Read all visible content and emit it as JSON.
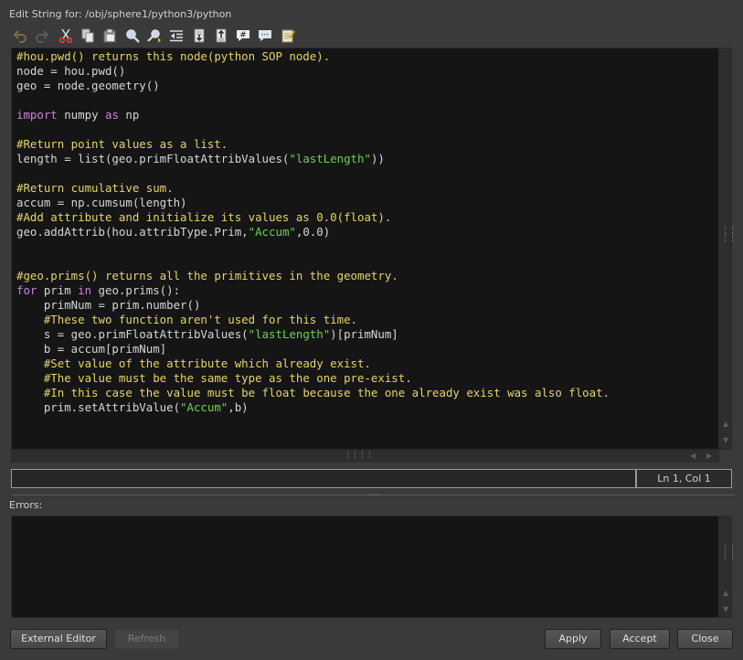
{
  "window": {
    "title": "Edit String for: /obj/sphere1/python3/python"
  },
  "toolbar": {
    "buttons": [
      {
        "name": "undo-icon"
      },
      {
        "name": "redo-icon"
      },
      {
        "name": "cut-icon"
      },
      {
        "name": "copy-icon"
      },
      {
        "name": "paste-icon"
      },
      {
        "name": "find-icon"
      },
      {
        "name": "replace-icon"
      },
      {
        "name": "outdent-icon"
      },
      {
        "name": "indent-icon"
      },
      {
        "name": "unindent-icon"
      },
      {
        "name": "comment-icon"
      },
      {
        "name": "uncomment-icon"
      },
      {
        "name": "notepad-icon"
      }
    ]
  },
  "editor": {
    "lines": [
      [
        {
          "t": "#hou.pwd() returns this node(python SOP node).",
          "c": "c"
        }
      ],
      [
        {
          "t": "node = hou.pwd()"
        }
      ],
      [
        {
          "t": "geo = node.geometry()"
        }
      ],
      [],
      [
        {
          "t": "import",
          "c": "k"
        },
        {
          "t": " numpy "
        },
        {
          "t": "as",
          "c": "k"
        },
        {
          "t": " np"
        }
      ],
      [],
      [
        {
          "t": "#Return point values as a list.",
          "c": "c"
        }
      ],
      [
        {
          "t": "length = list(geo.primFloatAttribValues("
        },
        {
          "t": "\"lastLength\"",
          "c": "s"
        },
        {
          "t": "))"
        }
      ],
      [],
      [
        {
          "t": "#Return cumulative sum.",
          "c": "c"
        }
      ],
      [
        {
          "t": "accum = np.cumsum(length)"
        }
      ],
      [
        {
          "t": "#Add attribute and initialize its values as 0.0(float).",
          "c": "c"
        }
      ],
      [
        {
          "t": "geo.addAttrib(hou.attribType.Prim,"
        },
        {
          "t": "\"Accum\"",
          "c": "s"
        },
        {
          "t": ",0.0)"
        }
      ],
      [],
      [],
      [
        {
          "t": "#geo.prims() returns all the primitives in the geometry.",
          "c": "c"
        }
      ],
      [
        {
          "t": "for",
          "c": "k"
        },
        {
          "t": " prim "
        },
        {
          "t": "in",
          "c": "k"
        },
        {
          "t": " geo.prims():"
        }
      ],
      [
        {
          "t": "    primNum = prim.number()"
        }
      ],
      [
        {
          "t": "    "
        },
        {
          "t": "#These two function aren't used for this time.",
          "c": "c"
        }
      ],
      [
        {
          "t": "    s = geo.primFloatAttribValues("
        },
        {
          "t": "\"lastLength\"",
          "c": "s"
        },
        {
          "t": ")[primNum]"
        }
      ],
      [
        {
          "t": "    b = accum[primNum]"
        }
      ],
      [
        {
          "t": "    "
        },
        {
          "t": "#Set value of the attribute which already exist.",
          "c": "c"
        }
      ],
      [
        {
          "t": "    "
        },
        {
          "t": "#The value must be the same type as the one pre-exist.",
          "c": "c"
        }
      ],
      [
        {
          "t": "    "
        },
        {
          "t": "#In this case the value must be float because the one already exist was also float.",
          "c": "c"
        }
      ],
      [
        {
          "t": "    prim.setAttribValue("
        },
        {
          "t": "\"Accum\"",
          "c": "s"
        },
        {
          "t": ",b)"
        }
      ]
    ]
  },
  "status": {
    "command": "",
    "cursor_position": "Ln 1, Col 1"
  },
  "errors": {
    "label": "Errors:",
    "text": ""
  },
  "buttons": {
    "external_editor": "External Editor",
    "refresh": "Refresh",
    "apply": "Apply",
    "accept": "Accept",
    "close": "Close"
  }
}
